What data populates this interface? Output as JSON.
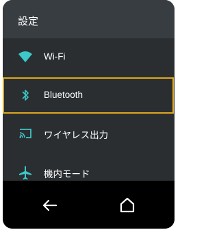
{
  "header": {
    "title": "設定"
  },
  "settings": {
    "items": [
      {
        "id": "wifi",
        "label": "Wi-Fi",
        "icon": "wifi-icon"
      },
      {
        "id": "bluetooth",
        "label": "Bluetooth",
        "icon": "bluetooth-icon",
        "focused": true
      },
      {
        "id": "wireless-display",
        "label": "ワイヤレス出力",
        "icon": "cast-icon"
      },
      {
        "id": "airplane",
        "label": "機内モード",
        "icon": "airplane-icon"
      }
    ]
  },
  "nav": {
    "back_icon": "back-arrow-icon",
    "home_icon": "home-icon"
  },
  "colors": {
    "header_bg": "#383d41",
    "list_bg": "#2a2e31",
    "accent": "#3cc8c8",
    "focus_border": "#e0a81f",
    "nav_bg": "#000000"
  }
}
